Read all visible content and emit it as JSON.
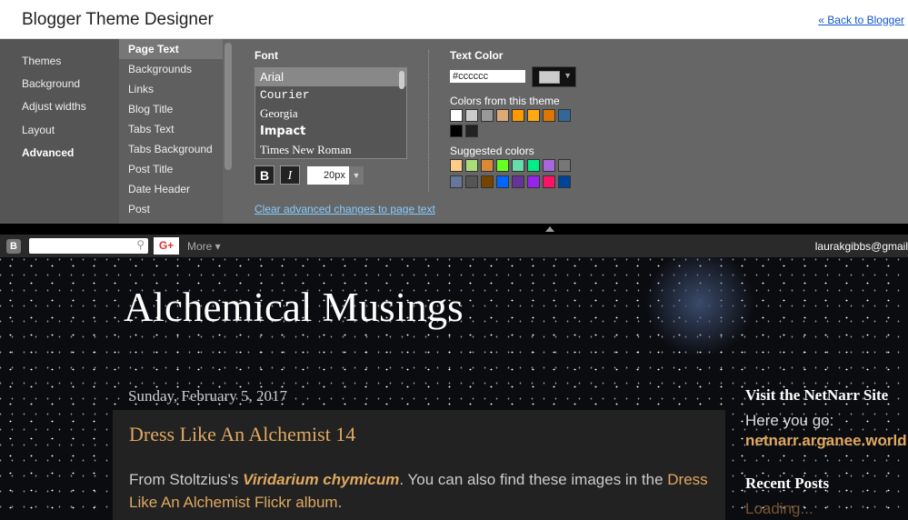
{
  "header": {
    "title": "Blogger Theme Designer",
    "back_link": "« Back to Blogger"
  },
  "nav_main": [
    "Themes",
    "Background",
    "Adjust widths",
    "Layout",
    "Advanced"
  ],
  "nav_main_selected": "Advanced",
  "nav_sub": [
    "Page Text",
    "Backgrounds",
    "Links",
    "Blog Title",
    "Tabs Text",
    "Tabs Background",
    "Post Title",
    "Date Header",
    "Post"
  ],
  "nav_sub_selected": "Page Text",
  "font": {
    "label": "Font",
    "options": [
      "Arial",
      "Courier",
      "Georgia",
      "Impact",
      "Times New Roman"
    ],
    "selected": "Arial",
    "bold": "B",
    "italic": "I",
    "size": "20px"
  },
  "clear_link": "Clear advanced changes to page text",
  "text_color": {
    "label": "Text Color",
    "value": "#cccccc",
    "theme_label": "Colors from this theme",
    "theme_colors": [
      "#ffffff",
      "#cccccc",
      "#999999",
      "#ddaa77",
      "#ff9900",
      "#ffaa11",
      "#dd7700",
      "#336699",
      "#000000",
      "#222222"
    ],
    "suggested_label": "Suggested colors",
    "suggested_colors": [
      "#ffcc88",
      "#aadd77",
      "#dd8833",
      "#66ff22",
      "#66ddaa",
      "#00ee88",
      "#aa66dd",
      "#777777",
      "#667799",
      "#555555",
      "#774400",
      "#0066ff",
      "#663399",
      "#9922ee",
      "#ff1166",
      "#004499"
    ]
  },
  "navbar": {
    "gplus": "G+",
    "more": "More ▾",
    "user": "laurakgibbs@gmail"
  },
  "blog": {
    "title": "Alchemical Musings",
    "date": "Sunday, February 5, 2017",
    "post_title": "Dress Like An Alchemist 14",
    "body_1": "From Stoltzius's ",
    "body_em": "Viridarium chymicum",
    "body_2": ". You can also find these images in the ",
    "body_link": "Dress Like An Alchemist Flickr album",
    "body_3": ".",
    "side_title": "Visit the NetNarr Site",
    "side_text": "Here you go:",
    "side_link": "netnarr.arganee.world",
    "recent_title": "Recent Posts",
    "recent_loading": "Loading..."
  }
}
